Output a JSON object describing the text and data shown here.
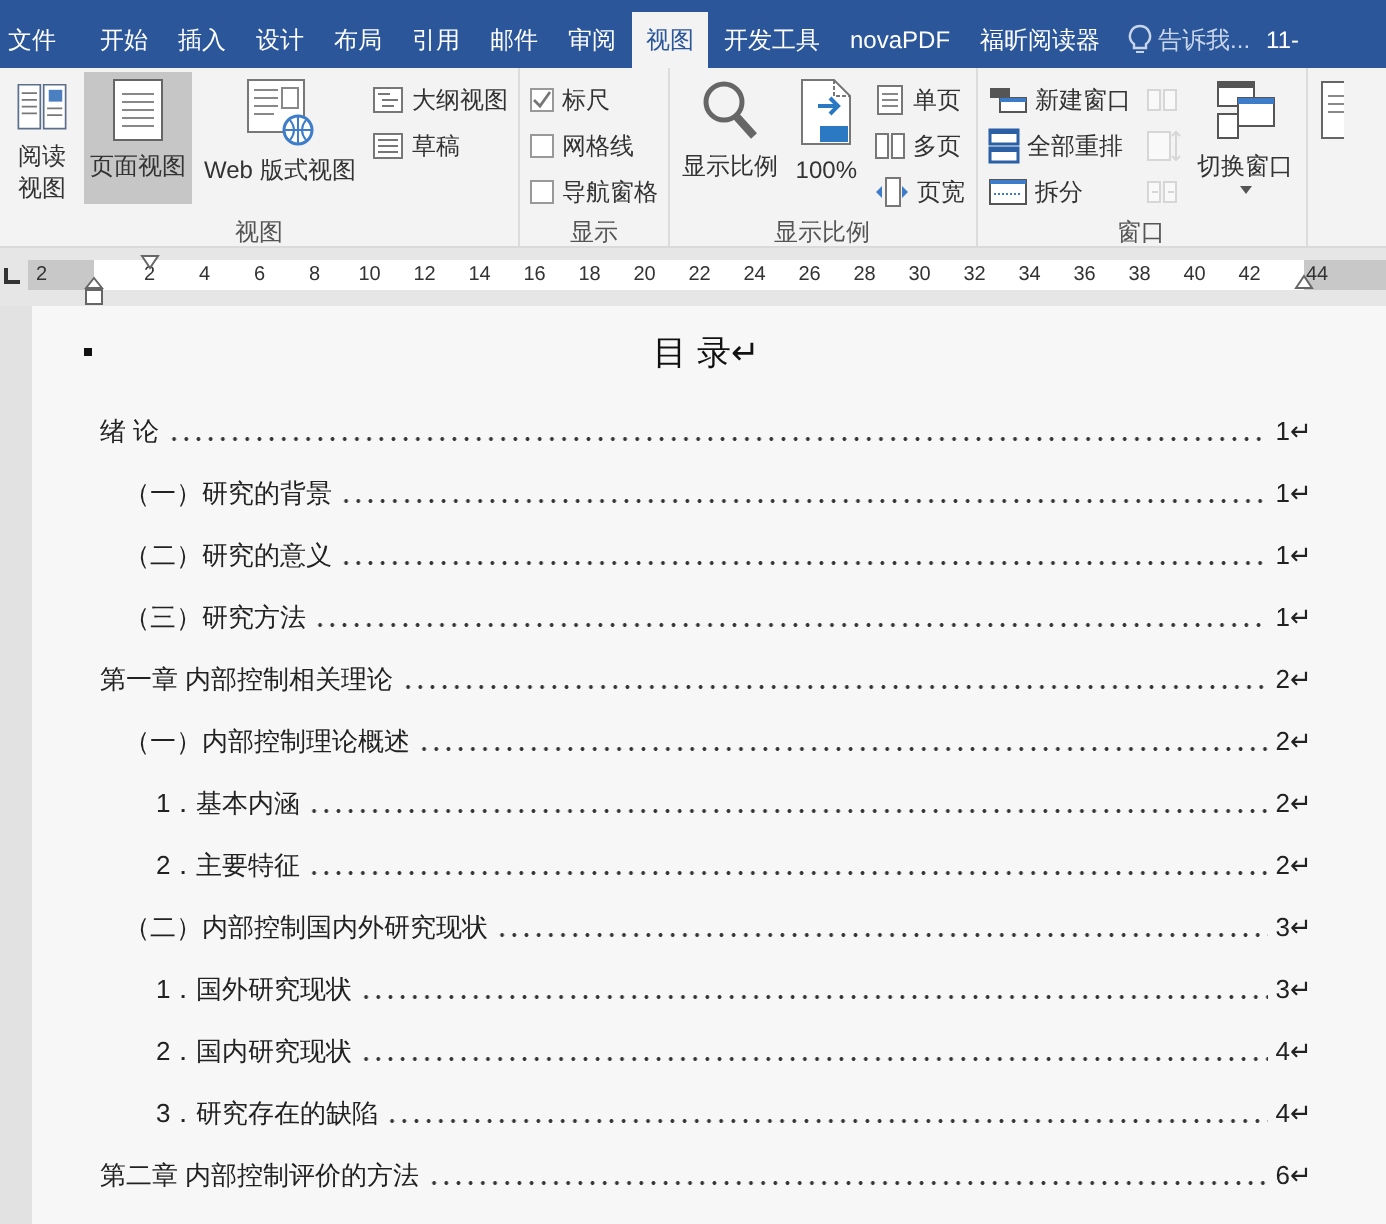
{
  "tabs": [
    {
      "label": "文件",
      "kind": "file",
      "selected": false
    },
    {
      "label": "开始",
      "kind": "tab",
      "selected": false
    },
    {
      "label": "插入",
      "kind": "tab",
      "selected": false
    },
    {
      "label": "设计",
      "kind": "tab",
      "selected": false
    },
    {
      "label": "布局",
      "kind": "tab",
      "selected": false
    },
    {
      "label": "引用",
      "kind": "tab",
      "selected": false
    },
    {
      "label": "邮件",
      "kind": "tab",
      "selected": false
    },
    {
      "label": "审阅",
      "kind": "tab",
      "selected": false
    },
    {
      "label": "视图",
      "kind": "tab",
      "selected": true
    },
    {
      "label": "开发工具",
      "kind": "tab",
      "selected": false
    },
    {
      "label": "novaPDF",
      "kind": "tab",
      "selected": false
    },
    {
      "label": "福昕阅读器",
      "kind": "tab",
      "selected": false
    }
  ],
  "tell_me": {
    "placeholder": "告诉我..."
  },
  "user_label": "11-",
  "ribbon": [
    {
      "label": "视图",
      "columns": [
        {
          "kind": "large",
          "label": "阅读视图",
          "selected": false
        },
        {
          "kind": "large",
          "label": "页面视图",
          "selected": true
        },
        {
          "kind": "large",
          "label": "Web 版式视图",
          "selected": false
        },
        {
          "kind": "stack",
          "items": [
            {
              "kind": "small",
              "label": "大纲视图"
            },
            {
              "kind": "small",
              "label": "草稿"
            }
          ]
        }
      ]
    },
    {
      "label": "显示",
      "columns": [
        {
          "kind": "stack",
          "items": [
            {
              "kind": "checkbox",
              "label": "标尺",
              "checked": true
            },
            {
              "kind": "checkbox",
              "label": "网格线",
              "checked": false
            },
            {
              "kind": "checkbox",
              "label": "导航窗格",
              "checked": false
            }
          ]
        }
      ]
    },
    {
      "label": "显示比例",
      "columns": [
        {
          "kind": "large",
          "label": "显示比例"
        },
        {
          "kind": "large",
          "label": "100%"
        },
        {
          "kind": "stack",
          "items": [
            {
              "kind": "small",
              "label": "单页"
            },
            {
              "kind": "small",
              "label": "多页"
            },
            {
              "kind": "small",
              "label": "页宽"
            }
          ]
        }
      ]
    },
    {
      "label": "窗口",
      "columns": [
        {
          "kind": "stack",
          "items": [
            {
              "kind": "small",
              "label": "新建窗口"
            },
            {
              "kind": "small",
              "label": "全部重排"
            },
            {
              "kind": "small",
              "label": "拆分"
            }
          ]
        },
        {
          "kind": "stack",
          "items": [
            {
              "kind": "icon",
              "disabled": true
            },
            {
              "kind": "icon",
              "disabled": true
            },
            {
              "kind": "icon",
              "disabled": true
            }
          ]
        },
        {
          "kind": "large",
          "label": "切换窗口",
          "dropdown": true
        }
      ]
    }
  ],
  "ruler": {
    "left_labels": [
      "2"
    ],
    "labels": [
      "2",
      "4",
      "6",
      "8",
      "10",
      "12",
      "14",
      "16",
      "18",
      "20",
      "22",
      "24",
      "26",
      "28",
      "30",
      "32",
      "34",
      "36",
      "38",
      "40",
      "42"
    ],
    "right_labels": [
      "44"
    ]
  },
  "document": {
    "title": "目 录↵",
    "toc": [
      {
        "text": "绪 论",
        "page": "1↵",
        "children": [
          {
            "text": "（一）研究的背景",
            "page": "1↵"
          },
          {
            "text": "（二）研究的意义",
            "page": "1↵"
          },
          {
            "text": "（三）研究方法",
            "page": "1↵"
          }
        ]
      },
      {
        "text": "第一章  内部控制相关理论",
        "page": "2↵",
        "children": [
          {
            "text": "（一）内部控制理论概述",
            "page": "2↵",
            "children": [
              {
                "text": "1．基本内涵",
                "page": "2↵"
              },
              {
                "text": "2．主要特征",
                "page": "2↵"
              }
            ]
          },
          {
            "text": "（二）内部控制国内外研究现状",
            "page": "3↵",
            "children": [
              {
                "text": "1．国外研究现状",
                "page": "3↵"
              },
              {
                "text": "2．国内研究现状",
                "page": "4↵"
              },
              {
                "text": "3．研究存在的缺陷",
                "page": "4↵"
              }
            ]
          }
        ]
      },
      {
        "text": "第二章  内部控制评价的方法",
        "page": "6↵"
      }
    ]
  }
}
